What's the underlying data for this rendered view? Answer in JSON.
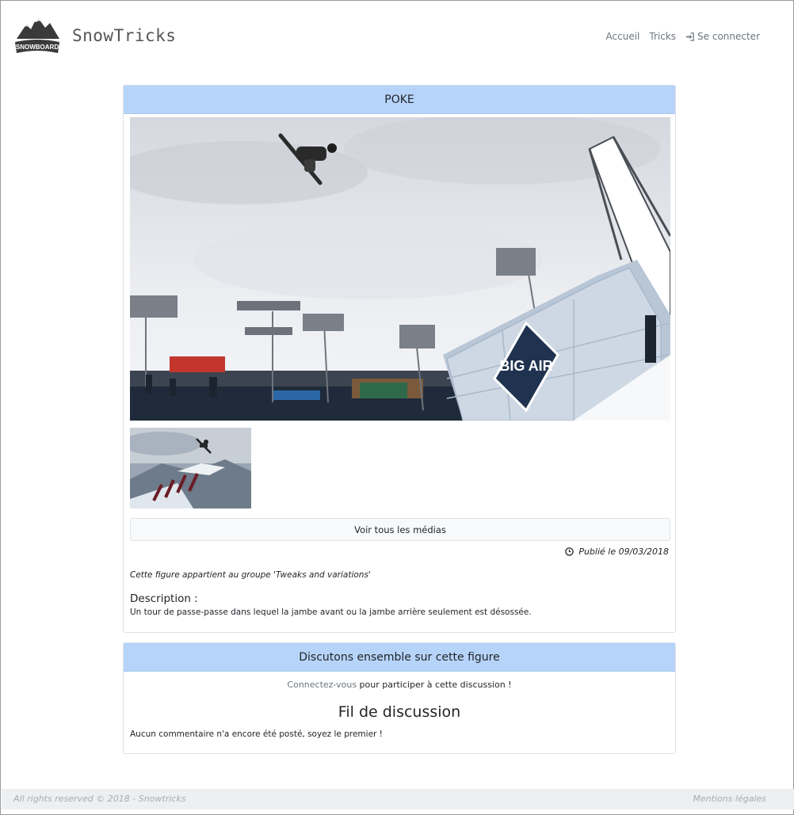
{
  "header": {
    "logo_text": "SNOWBOARD",
    "brand_name": "SnowTricks",
    "nav": [
      {
        "label": "Accueil"
      },
      {
        "label": "Tricks"
      },
      {
        "label": "Se connecter",
        "icon": "sign-in-icon"
      }
    ]
  },
  "trick": {
    "title": "POKE",
    "hero_banner_text": "BIG AIR",
    "show_all_media_label": "Voir tous les médias",
    "published": "Publié le 09/03/2018",
    "group_note": "Cette figure appartient au groupe 'Tweaks and variations'",
    "description_title": "Description :",
    "description_text": "Un tour de passe-passe dans lequel la jambe avant ou la jambe arrière seulement est désossée."
  },
  "discussion": {
    "header": "Discutons ensemble sur cette figure",
    "connect_link": "Connectez-vous",
    "connect_suffix": " pour participer à cette discussion !",
    "thread_title": "Fil de discussion",
    "empty_message": "Aucun commentaire n'a encore été posté, soyez le premier !"
  },
  "footer": {
    "copyright": "All rights reserved © 2018 - Snowtricks",
    "legal_link": "Mentions légales"
  },
  "colors": {
    "card_header_bg": "#b6d4f9",
    "footer_bg": "#eeeff1"
  }
}
